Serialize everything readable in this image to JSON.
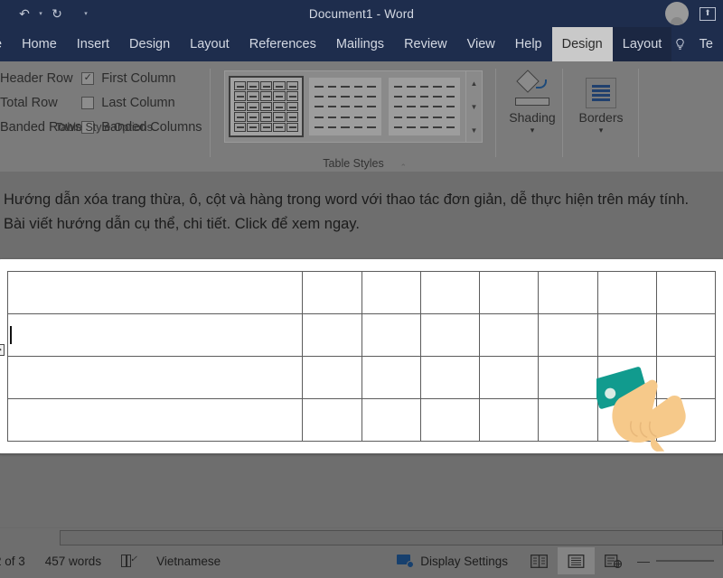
{
  "titlebar": {
    "document_title": "Document1  -  Word",
    "quick_access": [
      {
        "name": "undo",
        "glyph": "↶"
      },
      {
        "name": "undo-dropdown",
        "glyph": "▾"
      },
      {
        "name": "redo",
        "glyph": "↻"
      },
      {
        "name": "customize-quick-access-toolbar",
        "glyph": "▾"
      }
    ],
    "account_initials": "",
    "ribbon_display_options_glyph": "⬆"
  },
  "tabs": [
    {
      "label": "e",
      "active": false,
      "contextual": false
    },
    {
      "label": "Home",
      "active": false,
      "contextual": false
    },
    {
      "label": "Insert",
      "active": false,
      "contextual": false
    },
    {
      "label": "Design",
      "active": false,
      "contextual": false
    },
    {
      "label": "Layout",
      "active": false,
      "contextual": false
    },
    {
      "label": "References",
      "active": false,
      "contextual": false
    },
    {
      "label": "Mailings",
      "active": false,
      "contextual": false
    },
    {
      "label": "Review",
      "active": false,
      "contextual": false
    },
    {
      "label": "View",
      "active": false,
      "contextual": false
    },
    {
      "label": "Help",
      "active": false,
      "contextual": false
    },
    {
      "label": "Design",
      "active": true,
      "contextual": true
    },
    {
      "label": "Layout",
      "active": false,
      "contextual": true
    },
    {
      "label": "Te",
      "active": false,
      "contextual": false
    }
  ],
  "ribbon": {
    "table_style_options": {
      "group_label": "Table Style Options",
      "left_column": [
        {
          "label": "Header Row",
          "checked": false
        },
        {
          "label": "Total Row",
          "checked": false
        },
        {
          "label": "Banded Rows",
          "checked": false
        }
      ],
      "right_column": [
        {
          "label": "First Column",
          "checked": true,
          "check_glyph": "✓"
        },
        {
          "label": "Last Column",
          "checked": false,
          "check_glyph": ""
        },
        {
          "label": "Banded Columns",
          "checked": false,
          "check_glyph": ""
        }
      ]
    },
    "table_styles": {
      "group_label": "Table Styles",
      "swatches": [
        {
          "name": "plain-table-grid",
          "selected": true,
          "bordered": true
        },
        {
          "name": "table-style-2",
          "selected": false,
          "bordered": false
        },
        {
          "name": "table-style-3",
          "selected": false,
          "bordered": false
        }
      ],
      "scroll_buttons": [
        {
          "name": "gallery-scroll-up",
          "glyph": "▲"
        },
        {
          "name": "gallery-scroll-down",
          "glyph": "▼"
        },
        {
          "name": "gallery-more",
          "glyph": "▼"
        }
      ]
    },
    "shading": {
      "label": "Shading",
      "caret": "▾"
    },
    "borders": {
      "label": "Borders",
      "caret": "▾"
    },
    "collapse_ribbon_glyph": "⌃"
  },
  "document": {
    "body_text": "Hướng dẫn xóa trang thừa, ô, cột và hàng trong word với thao tác đơn giản, dễ thực hiện trên máy tính. Bài viết hướng dẫn cụ thể, chi tiết. Click để xem ngay.",
    "table": {
      "rows": 4,
      "columns": 8,
      "cells": [
        [
          "",
          "",
          "",
          "",
          "",
          "",
          "",
          ""
        ],
        [
          "",
          "",
          "",
          "",
          "",
          "",
          "",
          ""
        ],
        [
          "",
          "",
          "",
          "",
          "",
          "",
          "",
          ""
        ],
        [
          "",
          "",
          "",
          "",
          "",
          "",
          "",
          ""
        ]
      ],
      "caret_row": 1,
      "caret_column": 0,
      "move_handle_glyph": "✥"
    }
  },
  "cursor": {
    "type": "pointing-hand",
    "skin_color": "#f6c98a",
    "sleeve_color": "#119b8e",
    "button_color": "#d9ebe4"
  },
  "statusbar": {
    "page_indicator": "2 of 3",
    "word_count": "457 words",
    "proofing_icon": "proofing-errors-icon",
    "language": "Vietnamese",
    "display_settings": "Display Settings",
    "views": [
      {
        "name": "read-mode-view",
        "active": false
      },
      {
        "name": "print-layout-view",
        "active": true
      },
      {
        "name": "web-layout-view",
        "active": false
      }
    ],
    "zoom_out_glyph": "—"
  },
  "colors": {
    "title_bar": "#1e2d4d",
    "ribbon_bg": "#7b7b7b",
    "doc_bg": "#6e6e6e",
    "page_bg": "#ffffff",
    "active_tab_bg": "#c9c9c9",
    "accent_blue": "#17406e"
  }
}
